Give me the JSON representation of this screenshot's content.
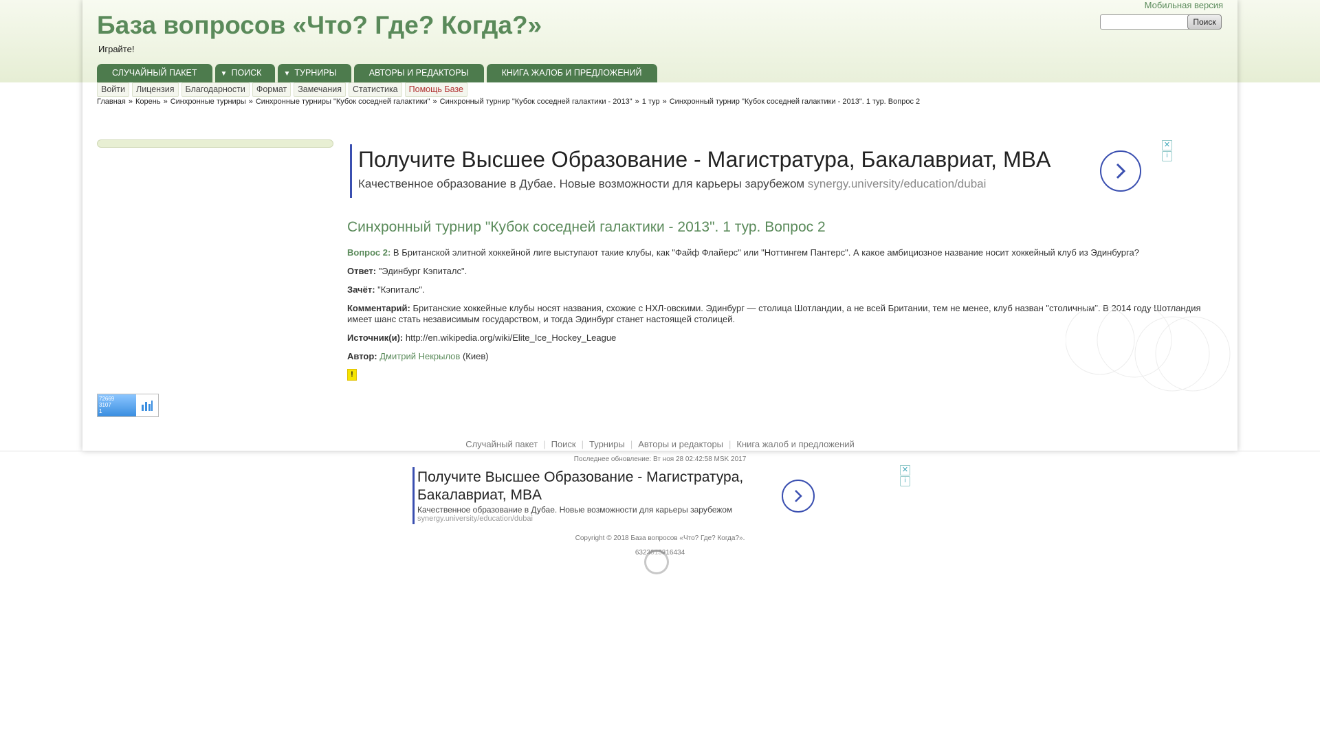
{
  "header": {
    "site_title": "База вопросов «Что? Где? Когда?»",
    "slogan": "Играйте!",
    "mobile_link": "Мобильная версия",
    "search_value": "",
    "search_button": "Поиск"
  },
  "nav": {
    "random_package": "СЛУЧАЙНЫЙ ПАКЕТ",
    "search": "ПОИСК",
    "tournaments": "ТУРНИРЫ",
    "authors": "АВТОРЫ И РЕДАКТОРЫ",
    "complaints": "КНИГА ЖАЛОБ И ПРЕДЛОЖЕНИЙ",
    "dropdown_arrow": "▼"
  },
  "subnav": [
    "Войти",
    "Лицензия",
    "Благодарности",
    "Формат",
    "Замечания",
    "Статистика",
    "Помощь Базе"
  ],
  "breadcrumb": {
    "items": [
      "Главная",
      "Корень",
      "Синхронные турниры",
      "Синхронные турниры \"Кубок соседней галактики\"",
      "Синхронный турнир \"Кубок соседней галактики - 2013\"",
      "1 тур",
      "Синхронный турнир \"Кубок соседней галактики - 2013\". 1 тур. Вопрос 2"
    ],
    "separator": "»"
  },
  "ad_top": {
    "title": "Получите Высшее Образование - Магистратура, Бакалавриат, MBA",
    "description": "Качественное образование в Дубае. Новые возможности для карьеры зарубежом",
    "url": "synergy.university/education/dubai",
    "close": "✕",
    "info": "i"
  },
  "question": {
    "heading": "Синхронный турнир \"Кубок соседней галактики - 2013\". 1 тур. Вопрос 2",
    "number_label": "Вопрос 2:",
    "text": "В Британской элитной хоккейной лиге выступают такие клубы, как \"Файф Флайерс\" или \"Ноттингем Пантерс\". А какое амбициозное название носит хоккейный клуб из Эдинбурга?",
    "answer_label": "Ответ:",
    "answer": "\"Эдинбург Кэпиталс\".",
    "accepted_label": "Зачёт:",
    "accepted": "\"Кэпиталс\".",
    "comment_label": "Комментарий:",
    "comment": "Британские хоккейные клубы носят названия, схожие с НХЛ-овскими. Эдинбург — столица Шотландии, а не всей Британии, тем не менее, клуб назван \"столичным\". В 2014 году Шотландия имеет шанс стать независимым государством, и тогда Эдинбург станет настоящей столицей.",
    "source_label": "Источник(и):",
    "source": "http://en.wikipedia.org/wiki/Elite_Ice_Hockey_League",
    "author_label": "Автор:",
    "author": "Дмитрий Некрылов",
    "author_city": "(Киев)",
    "warning": "!"
  },
  "counter": {
    "line1": "72669",
    "line2": "3107",
    "line3": "1"
  },
  "footer": {
    "nav": [
      "Случайный пакет",
      "Поиск",
      "Турниры",
      "Авторы и редакторы",
      "Книга жалоб и предложений"
    ],
    "updated": "Последнее обновление: Вт ноя 28 02:42:58 MSK 2017",
    "copyright": "Copyright © 2018 База вопросов «Что? Где? Когда?».",
    "id": "6323013316434"
  },
  "ad_bottom": {
    "title": "Получите Высшее Образование - Магистратура, Бакалавриат, MBA",
    "description": "Качественное образование в Дубае. Новые возможности для карьеры зарубежом",
    "url": "synergy.university/education/dubai",
    "close": "✕",
    "info": "i"
  },
  "colors": {
    "brand_green": "#5a8a5a",
    "nav_green": "#4d7b4d",
    "ad_blue": "#3a4fb0"
  }
}
